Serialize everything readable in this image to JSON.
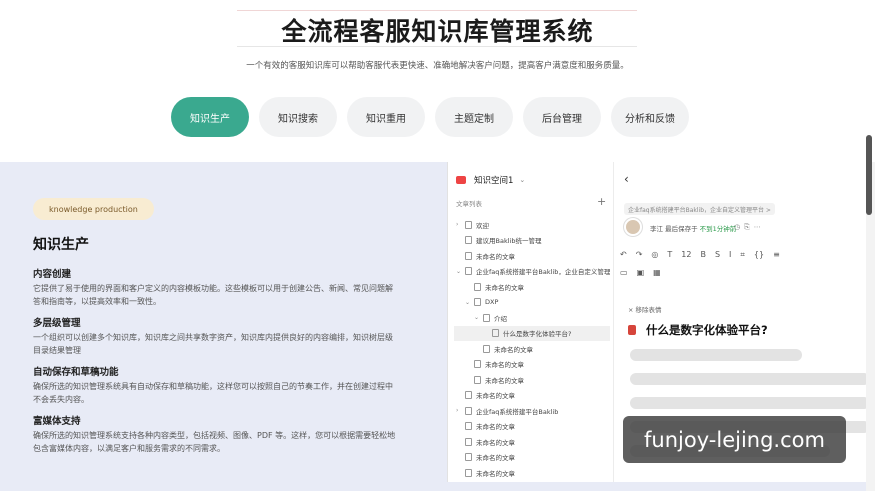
{
  "header": {
    "title": "全流程客服知识库管理系统",
    "subtitle": "一个有效的客服知识库可以帮助客服代表更快速、准确地解决客户问题，提高客户满意度和服务质量。"
  },
  "tabs": [
    {
      "label": "知识生产",
      "active": true
    },
    {
      "label": "知识搜索",
      "active": false
    },
    {
      "label": "知识重用",
      "active": false
    },
    {
      "label": "主题定制",
      "active": false
    },
    {
      "label": "后台管理",
      "active": false
    },
    {
      "label": "分析和反馈",
      "active": false
    }
  ],
  "section": {
    "badge": "knowledge production",
    "title": "知识生产",
    "features": [
      {
        "name": "内容创建",
        "desc": "它提供了易于使用的界面和客户定义的内容模板功能。这些模板可以用于创建公告、新闻、常见问题解答和指南等，以提高效率和一致性。"
      },
      {
        "name": "多层级管理",
        "desc": "一个组织可以创建多个知识库，知识库之间共享数字资产，知识库内提供良好的内容编排，知识树层级目录结果管理"
      },
      {
        "name": "自动保存和草稿功能",
        "desc": "确保所选的知识管理系统具有自动保存和草稿功能，这样您可以按照自己的节奏工作，并在创建过程中不会丢失内容。"
      },
      {
        "name": "富媒体支持",
        "desc": "确保所选的知识管理系统支持各种内容类型，包括视频、图像、PDF 等。这样，您可以根据需要轻松地包含富媒体内容，以满足客户和服务需求的不同需求。"
      }
    ]
  },
  "app": {
    "space_name": "知识空间1",
    "list_label": "文章列表",
    "tree": [
      {
        "label": "欢迎",
        "indent": 0,
        "arrow": "›"
      },
      {
        "label": "建议用Baklib统一管理",
        "indent": 0,
        "arrow": ""
      },
      {
        "label": "未命名的文章",
        "indent": 0,
        "arrow": ""
      },
      {
        "label": "企业faq系统搭建平台Baklib，企业自定义管理平台",
        "indent": 0,
        "arrow": "⌄"
      },
      {
        "label": "未命名的文章",
        "indent": 1,
        "arrow": ""
      },
      {
        "label": "DXP",
        "indent": 1,
        "arrow": "⌄"
      },
      {
        "label": "介绍",
        "indent": 2,
        "arrow": "⌄"
      },
      {
        "label": "什么是数字化体验平台?",
        "indent": 3,
        "arrow": "",
        "selected": true
      },
      {
        "label": "未命名的文章",
        "indent": 2,
        "arrow": ""
      },
      {
        "label": "未命名的文章",
        "indent": 1,
        "arrow": ""
      },
      {
        "label": "未命名的文章",
        "indent": 1,
        "arrow": ""
      },
      {
        "label": "未命名的文章",
        "indent": 0,
        "arrow": ""
      },
      {
        "label": "企业faq系统搭建平台Baklib",
        "indent": 0,
        "arrow": "›"
      },
      {
        "label": "未命名的文章",
        "indent": 0,
        "arrow": ""
      },
      {
        "label": "未命名的文章",
        "indent": 0,
        "arrow": ""
      },
      {
        "label": "未命名的文章",
        "indent": 0,
        "arrow": ""
      },
      {
        "label": "未命名的文章",
        "indent": 0,
        "arrow": ""
      }
    ],
    "breadcrumb": "企业faq系统搭建平台Baklib，企业自定义管理平台 >",
    "author": "李江  最后保存于",
    "save_status": "不到1分钟前",
    "doc_meta": "× 移除表情",
    "doc_title": "什么是数字化体验平台?"
  },
  "watermark": "funjoy-lejing.com",
  "colors": {
    "accent": "#3aa98f",
    "badge_bg": "#f8ecd2",
    "panel_bg": "#e8ebf6"
  }
}
